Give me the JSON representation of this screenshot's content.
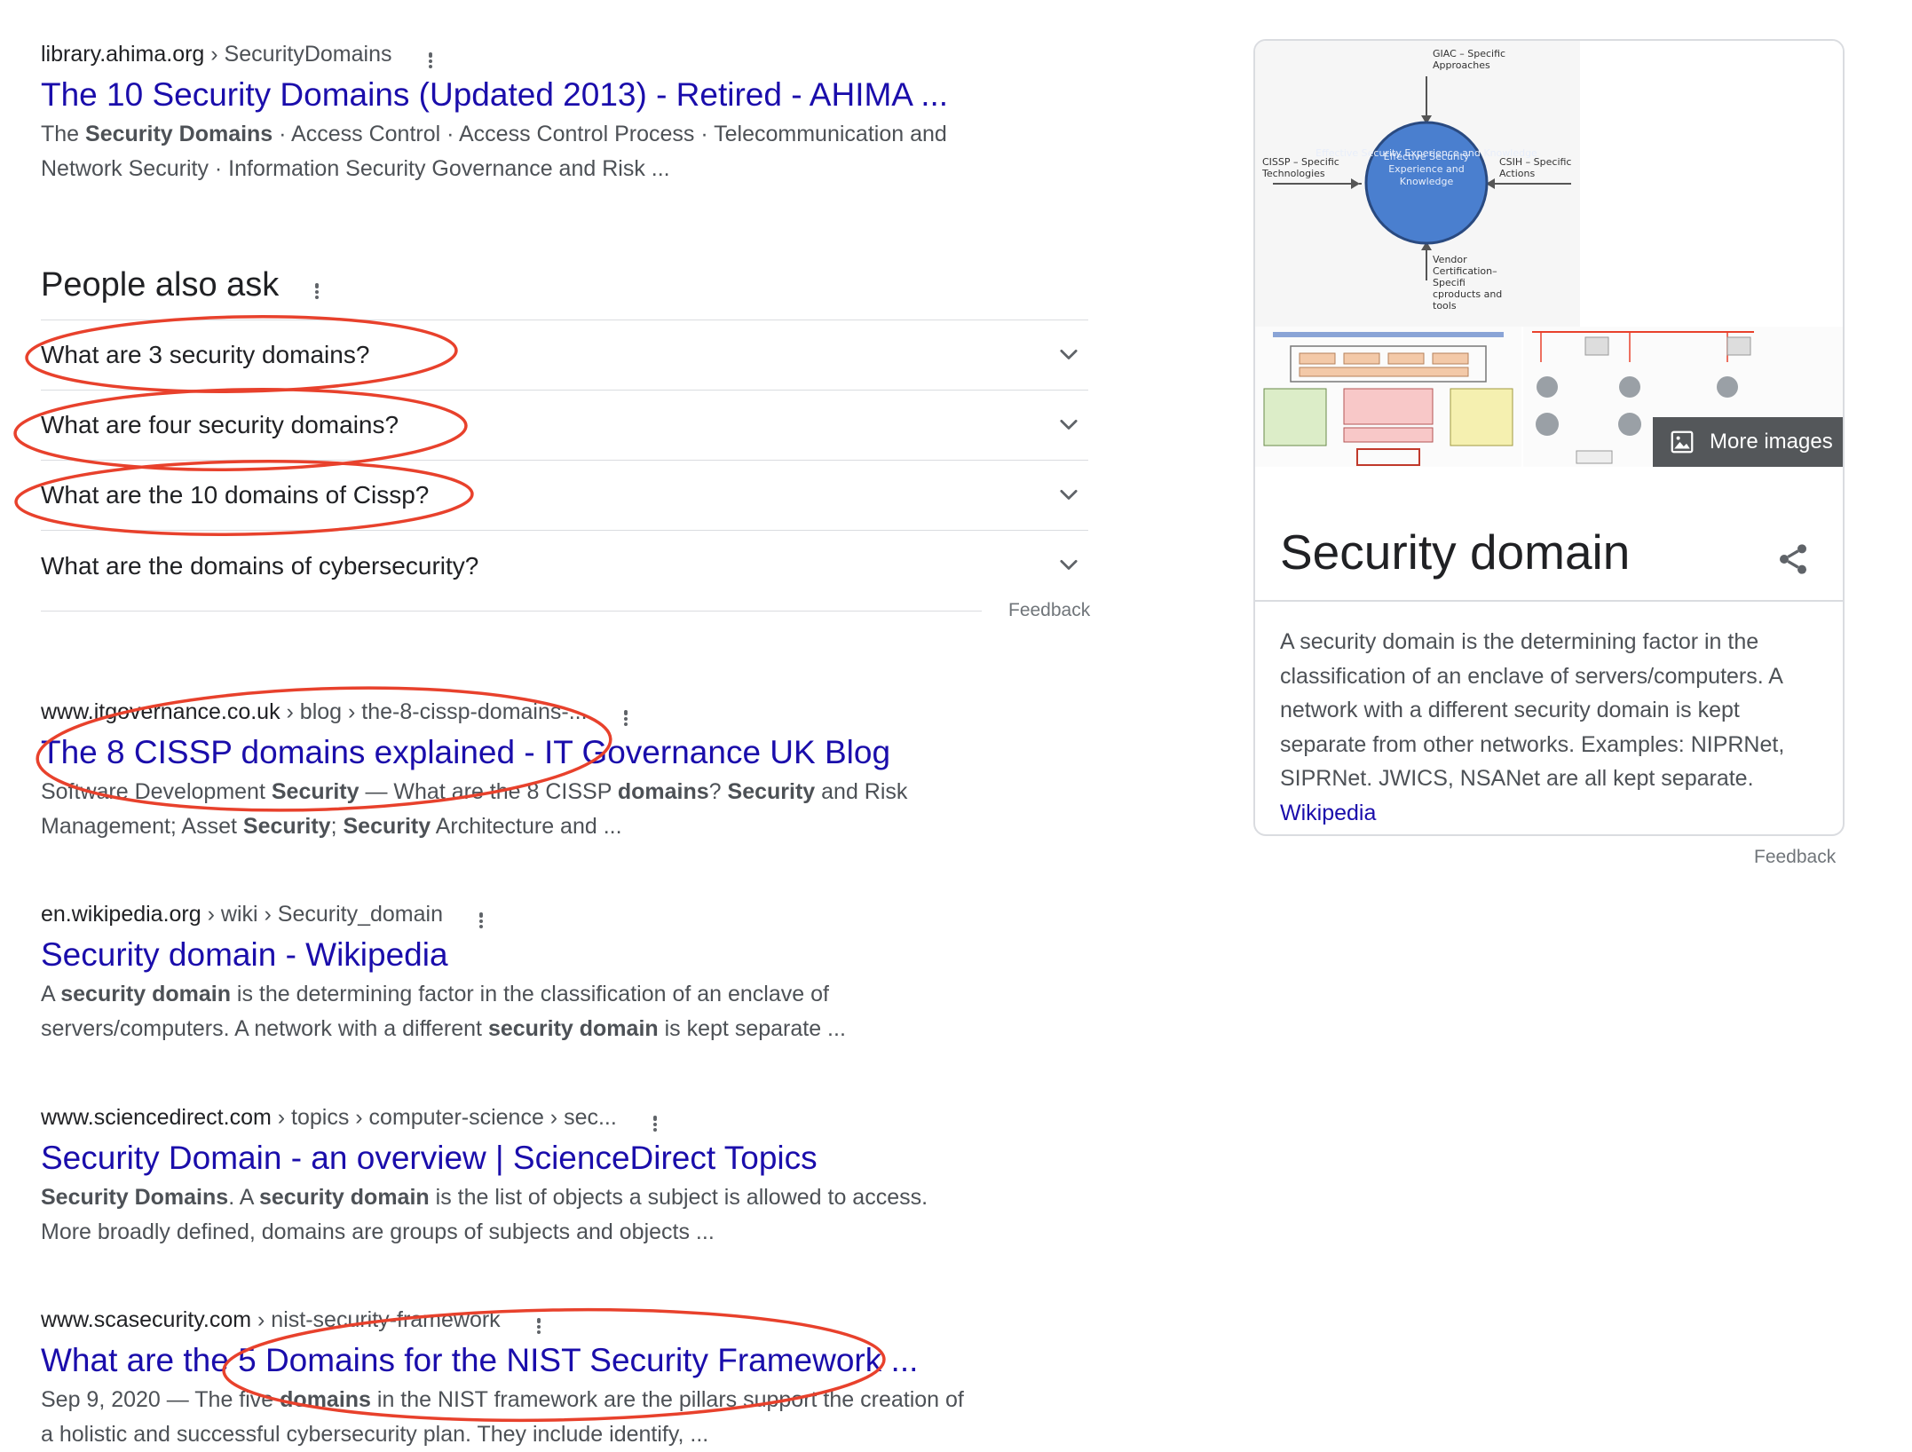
{
  "results": [
    {
      "domain": "library.ahima.org",
      "path": " › SecurityDomains",
      "title": "The 10 Security Domains (Updated 2013) - Retired - AHIMA ...",
      "snippet_html": "The <b>Security Domains</b> · Access Control · Access Control Process · Telecommunication and Network Security · Information Security Governance and Risk ..."
    },
    {
      "domain": "www.itgovernance.co.uk",
      "path": " › blog › the-8-cissp-domains-...",
      "title": "The 8 CISSP domains explained - IT Governance UK Blog",
      "snippet_html": "Software Development <b>Security</b> — What are the 8 CISSP <b>domains</b>? <b>Security</b> and Risk Management; Asset <b>Security</b>; <b>Security</b> Architecture and ..."
    },
    {
      "domain": "en.wikipedia.org",
      "path": " › wiki › Security_domain",
      "title": "Security domain - Wikipedia",
      "snippet_html": "A <b>security domain</b> is the determining factor in the classification of an enclave of servers/computers. A network with a different <b>security domain</b> is kept separate ..."
    },
    {
      "domain": "www.sciencedirect.com",
      "path": " › topics › computer-science › sec...",
      "title": "Security Domain - an overview | ScienceDirect Topics",
      "snippet_html": "<b>Security Domains</b>. A <b>security domain</b> is the list of objects a subject is allowed to access. More broadly defined, domains are groups of subjects and objects ..."
    },
    {
      "domain": "www.scasecurity.com",
      "path": " › nist-security-framework",
      "title": "What are the 5 Domains for the NIST Security Framework ...",
      "snippet_html": "Sep 9, 2020 — The five <b>domains</b> in the NIST framework are the pillars support the creation of a holistic and successful cybersecurity plan. They include identify, ..."
    }
  ],
  "paa": {
    "title": "People also ask",
    "questions": [
      "What are 3 security domains?",
      "What are four security domains?",
      "What are the 10 domains of Cissp?",
      "What are the domains of cybersecurity?"
    ],
    "feedback": "Feedback"
  },
  "knowledge_panel": {
    "title": "Security domain",
    "description": "A security domain is the determining factor in the classification of an enclave of servers/computers. A network with a different security domain is kept separate from other networks. Examples: NIPRNet, SIPRNet. JWICS, NSANet are all kept separate.",
    "source_link": "Wikipedia",
    "more_images": "More images",
    "feedback": "Feedback",
    "diagram": {
      "top": "GIAC – Specific Approaches",
      "left": "CISSP – Specific Technologies",
      "right": "CSIH – Specific Actions",
      "center": "Effective Security Experience and Knowledge",
      "bottom": "Vendor Certification– Specifi cproducts and tools"
    }
  },
  "colors": {
    "link": "#1a0dab",
    "annotation": "#e8412c",
    "snippet": "#4d5156"
  }
}
